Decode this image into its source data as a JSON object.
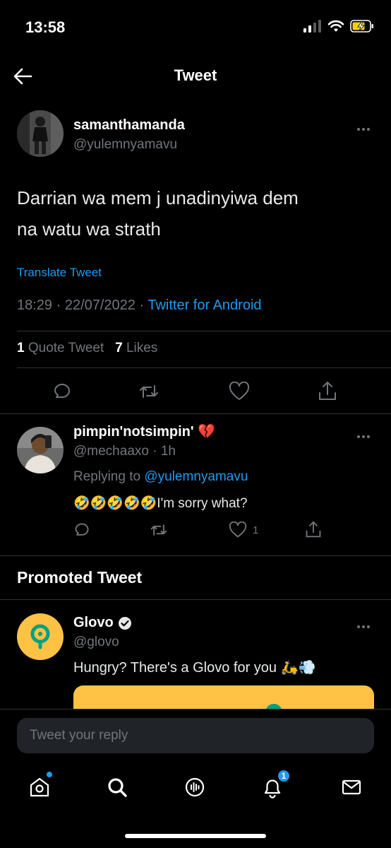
{
  "status_bar": {
    "time": "13:58"
  },
  "header": {
    "title": "Tweet"
  },
  "tweet": {
    "display_name": "samanthamanda",
    "handle": "@yulemnyamavu",
    "text_line1": "Darrian wa mem j unadinyiwa dem",
    "text_line2": "na watu wa strath",
    "translate": "Translate Tweet",
    "time": "18:29 · 22/07/2022 ·",
    "source": "Twitter for Android",
    "quote_count": "1",
    "quote_label": "Quote Tweet",
    "like_count": "7",
    "like_label": "Likes"
  },
  "reply": {
    "display_name": "pimpin'notsimpin'",
    "display_emoji": "💔",
    "handle_time": "@mechaaxo · 1h",
    "replying_prefix": "Replying to",
    "replying_handle": "@yulemnyamavu",
    "emojis": "🤣🤣🤣🤣🤣",
    "text": "I'm sorry what?",
    "like_count": "1"
  },
  "promoted": {
    "section_title": "Promoted Tweet",
    "display_name": "Glovo",
    "handle": "@glovo",
    "text": "Hungry? There's a Glovo for you",
    "emojis": "🛵💨"
  },
  "compose": {
    "placeholder": "Tweet your reply"
  },
  "bottom_nav": {
    "notifications_badge": "1"
  },
  "colors": {
    "accent": "#1d9bf0",
    "glovo_yellow": "#FFC244",
    "glovo_green": "#00A082",
    "background": "#000000"
  }
}
